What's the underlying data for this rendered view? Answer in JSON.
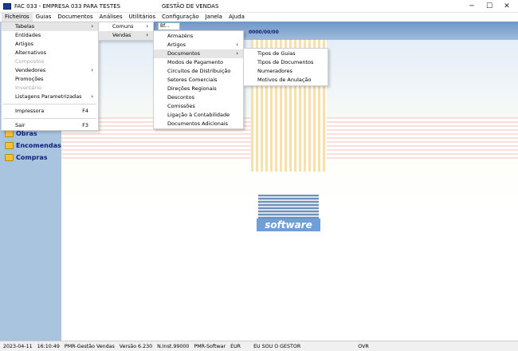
{
  "window": {
    "title": "FAC 033 - EMPRESA 033 PARA TESTES",
    "center_title": "GESTÃO DE VENDAS",
    "minimize": "─",
    "maximize": "☐",
    "close": "✕"
  },
  "menubar": [
    "Ficheiros",
    "Guias",
    "Documentos",
    "Análises",
    "Utilitários",
    "Configuração",
    "Janela",
    "Ajuda"
  ],
  "toolbar": {
    "date": "0000/00/00",
    "box_text": "Bf..."
  },
  "menu1": {
    "items": [
      {
        "label": "Tabelas",
        "arrow": "›",
        "state": "hl"
      },
      {
        "label": "Entidades"
      },
      {
        "label": "Artigos"
      },
      {
        "label": "Alternativos"
      },
      {
        "label": "Compostos",
        "state": "dis"
      },
      {
        "label": "Vendedores",
        "arrow": "›"
      },
      {
        "label": "Promoções"
      },
      {
        "label": "Inventário",
        "state": "dis"
      },
      {
        "label": "Listagens Parametrizadas",
        "arrow": "›"
      }
    ],
    "after_sep1": {
      "label": "Impressora",
      "shortcut": "F4"
    },
    "after_sep2": {
      "label": "Sair",
      "shortcut": "F3"
    }
  },
  "menu2": {
    "items": [
      {
        "label": "Comuns",
        "arrow": "›"
      },
      {
        "label": "Vendas",
        "arrow": "›",
        "state": "hl"
      }
    ]
  },
  "menu3": {
    "items": [
      {
        "label": "Armazéns"
      },
      {
        "label": "Artigos",
        "arrow": "›"
      },
      {
        "label": "Documentos",
        "arrow": "›",
        "state": "hl"
      },
      {
        "label": "Modos de Pagamento"
      },
      {
        "label": "Circuitos de Distribuição"
      },
      {
        "label": "Setores Comerciais"
      },
      {
        "label": "Direções Regionais"
      },
      {
        "label": "Descontos"
      },
      {
        "label": "Comissões"
      },
      {
        "label": "Ligação à Contabilidade"
      },
      {
        "label": "Documentos Adicionais"
      }
    ]
  },
  "menu4": {
    "items": [
      {
        "label": "Tipos de Guias"
      },
      {
        "label": "Tipos de Documentos"
      },
      {
        "label": "Numeradores"
      },
      {
        "label": "Motivos de Anulação"
      }
    ]
  },
  "leftpanel": [
    {
      "label": "Obras",
      "icon": "folder-icon"
    },
    {
      "label": "Encomendas",
      "icon": "folder-icon"
    },
    {
      "label": "Compras",
      "icon": "folder-icon"
    }
  ],
  "logo": {
    "text": "software"
  },
  "status": {
    "date": "2023-04-11",
    "time": "16:10:49",
    "app": "PMR-Gestão Vendas",
    "version": "Versão 6.230",
    "inst": "N.Inst.99000",
    "vendor": "PMR-Softwar",
    "currency": "EUR",
    "user": "EU SOU O GESTOR",
    "mode": "OVR"
  }
}
